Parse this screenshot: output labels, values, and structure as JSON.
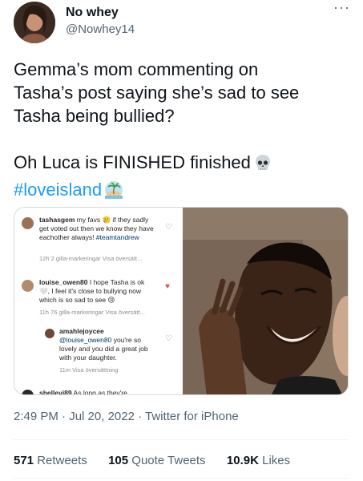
{
  "author": {
    "name": "No whey",
    "handle": "@Nowhey14"
  },
  "tweet": {
    "line1": "Gemma’s mom commenting on",
    "line2": "Tasha’s post saying she’s sad to see",
    "line3": "Tasha being bullied?",
    "line4": "Oh Luca is FINISHED finished",
    "hashtag": "#loveisland"
  },
  "screenshot_comments": [
    {
      "user": "tashasgem",
      "text": "my favs 🥲 if they sadly get voted out then we know they have eachother always!",
      "tag": "#teamtandrew",
      "meta": "12h   2 gilla-markeringar   Visa översätt..."
    },
    {
      "user": "louise_owen80",
      "text": "I hope Tasha is ok 🤍, I feel it's close to bullying now which is so sad to see 😢",
      "meta": "11h   76 gilla-markeringar   Visa översätt..."
    },
    {
      "user": "amahlejoycee",
      "mention": "@louise_owen80",
      "text": "you're so lovely and you did a great job with your daughter.",
      "meta": "11m   Visa översättning"
    },
    {
      "user": "shellevi89",
      "text": "As long as they're"
    }
  ],
  "timestamp": {
    "time": "2:49 PM",
    "date": "Jul 20, 2022",
    "source": "Twitter for iPhone"
  },
  "stats": {
    "retweets_count": "571",
    "retweets_label": "Retweets",
    "quotes_count": "105",
    "quotes_label": "Quote Tweets",
    "likes_count": "10.9K",
    "likes_label": "Likes"
  },
  "colors": {
    "link": "#1d9bf0",
    "muted": "#536471",
    "heart": "#ed4956"
  }
}
